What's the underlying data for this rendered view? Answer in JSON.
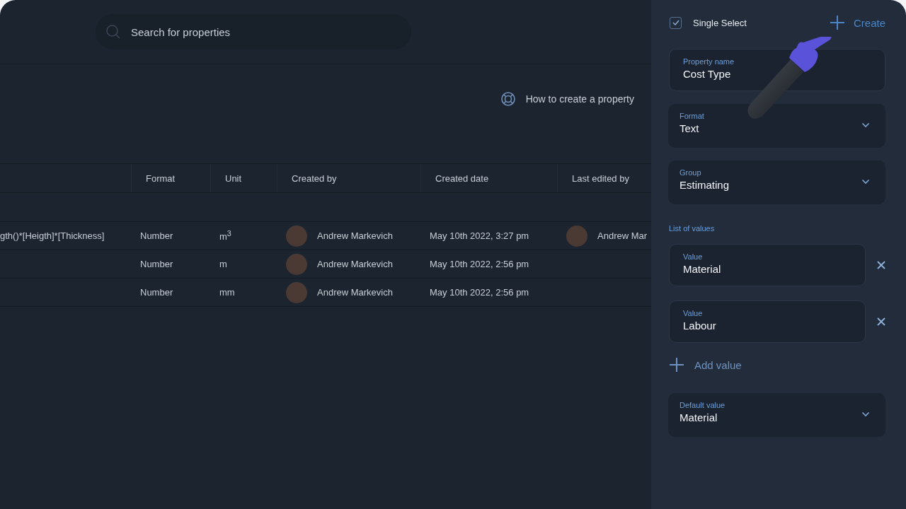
{
  "search": {
    "placeholder": "Search for properties"
  },
  "help_link": {
    "label": "How to create a property"
  },
  "table": {
    "columns": [
      "Format",
      "Unit",
      "Created by",
      "Created date",
      "Last edited by"
    ],
    "rows": [
      {
        "column_1": "gth()*[Heigth]*[Thickness]",
        "format": "Number",
        "unit": "m$^{3}$",
        "created_by": "Andrew Markevich",
        "created_date": "May 10th 2022, 3:27 pm",
        "last_edited_by": "Andrew Mar"
      },
      {
        "format": "Number",
        "unit": "m",
        "created_by": "Andrew Markevich",
        "created_date": "May 10th 2022, 2:56 pm"
      },
      {
        "format": "Number",
        "unit": "mm",
        "created_by": "Andrew Markevich",
        "created_date": "May 10th 2022, 2:56 pm"
      }
    ]
  },
  "panel": {
    "single_select": {
      "label": "Single Select",
      "checked": true
    },
    "create_button": {
      "label": "Create"
    },
    "fields": [
      {
        "kind": "text",
        "label": "Property name",
        "value": "Cost Type"
      },
      {
        "kind": "select",
        "label": "Format",
        "value": "Text"
      },
      {
        "kind": "select",
        "label": "Group",
        "value": "Estimating"
      }
    ],
    "list_title": "List of values",
    "values": [
      {
        "label": "Value",
        "value": "Material"
      },
      {
        "label": "Value",
        "value": "Labour"
      }
    ],
    "add_value": {
      "label": "Add value"
    },
    "default_field": {
      "kind": "select",
      "label": "Default value",
      "value": "Material"
    }
  }
}
